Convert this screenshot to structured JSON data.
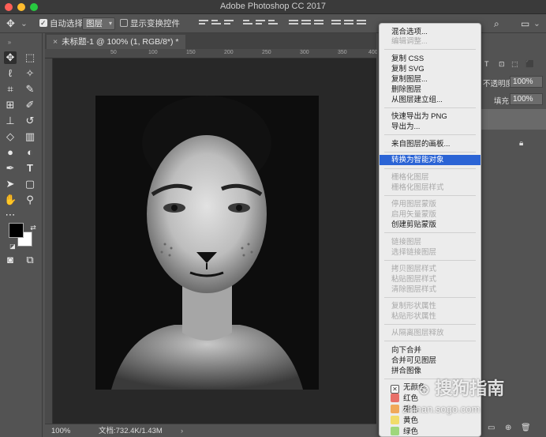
{
  "window": {
    "title": "Adobe Photoshop CC 2017"
  },
  "colors": {
    "close": "#fe5f57",
    "minimize": "#febc2e",
    "zoom": "#28c840",
    "highlight": "#2b64d5"
  },
  "options_bar": {
    "auto_select_label": "自动选择:",
    "auto_select_value": "图层",
    "show_transform_label": "显示变换控件"
  },
  "document_tab": {
    "label": "未标题-1 @ 100% (1, RGB/8*) *"
  },
  "ruler": {
    "ticks": [
      "50",
      "100",
      "150",
      "200",
      "250",
      "300",
      "350",
      "400"
    ]
  },
  "status": {
    "zoom": "100%",
    "doc_size": "文档:732.4K/1.43M"
  },
  "layers_panel": {
    "opacity_label": "不透明度:",
    "opacity_value": "100%",
    "fill_label": "填充:",
    "fill_value": "100%"
  },
  "context_menu": {
    "items": [
      {
        "label": "混合选项...",
        "disabled": false
      },
      {
        "label": "编辑调整...",
        "disabled": true
      },
      {
        "label": "复制 CSS",
        "disabled": false
      },
      {
        "label": "复制 SVG",
        "disabled": false
      },
      {
        "label": "复制图层...",
        "disabled": false
      },
      {
        "label": "删除图层",
        "disabled": false
      },
      {
        "label": "从图层建立组...",
        "disabled": false
      },
      {
        "label": "快速导出为 PNG",
        "disabled": false
      },
      {
        "label": "导出为...",
        "disabled": false
      },
      {
        "label": "来自图层的画板...",
        "disabled": false
      },
      {
        "label": "转换为智能对象",
        "disabled": false,
        "highlighted": true
      },
      {
        "label": "栅格化图层",
        "disabled": true
      },
      {
        "label": "栅格化图层样式",
        "disabled": true
      },
      {
        "label": "停用图层蒙版",
        "disabled": true
      },
      {
        "label": "启用矢量蒙版",
        "disabled": true
      },
      {
        "label": "创建剪贴蒙版",
        "disabled": false
      },
      {
        "label": "链接图层",
        "disabled": true
      },
      {
        "label": "选择链接图层",
        "disabled": true
      },
      {
        "label": "拷贝图层样式",
        "disabled": true
      },
      {
        "label": "粘贴图层样式",
        "disabled": true
      },
      {
        "label": "清除图层样式",
        "disabled": true
      },
      {
        "label": "复制形状属性",
        "disabled": true
      },
      {
        "label": "粘贴形状属性",
        "disabled": true
      },
      {
        "label": "从隔离图层释放",
        "disabled": true
      },
      {
        "label": "向下合并",
        "disabled": false
      },
      {
        "label": "合并可见图层",
        "disabled": false
      },
      {
        "label": "拼合图像",
        "disabled": false
      },
      {
        "label": "无颜色",
        "disabled": false
      },
      {
        "label": "红色",
        "disabled": false,
        "swatch": "#e8706a"
      },
      {
        "label": "橙色",
        "disabled": false,
        "swatch": "#f0a85a"
      },
      {
        "label": "黄色",
        "disabled": false,
        "swatch": "#f1dc6a"
      },
      {
        "label": "绿色",
        "disabled": false,
        "swatch": "#9fd77c"
      }
    ]
  },
  "watermark": {
    "brand": "搜狗指南",
    "url": "zhinan.sogo.com"
  }
}
